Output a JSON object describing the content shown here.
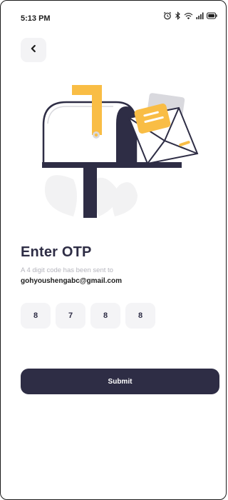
{
  "status_bar": {
    "time": "5:13 PM",
    "icons": [
      "alarm-icon",
      "bluetooth-icon",
      "wifi-icon",
      "signal-icon",
      "battery-icon"
    ]
  },
  "header": {
    "back_icon": "chevron-left-icon"
  },
  "illustration": {
    "name": "mailbox-with-envelope-illustration"
  },
  "main": {
    "title": "Enter OTP",
    "subtitle": "A 4 digit code has been sent to",
    "email": "gohyoushengabc@gmail.com",
    "otp_digits": [
      "8",
      "7",
      "8",
      "8"
    ],
    "submit_label": "Submit"
  },
  "colors": {
    "primary": "#2e2d45",
    "accent": "#f9bd45",
    "field_bg": "#f4f4f6",
    "muted_text": "#b5b5bd"
  }
}
